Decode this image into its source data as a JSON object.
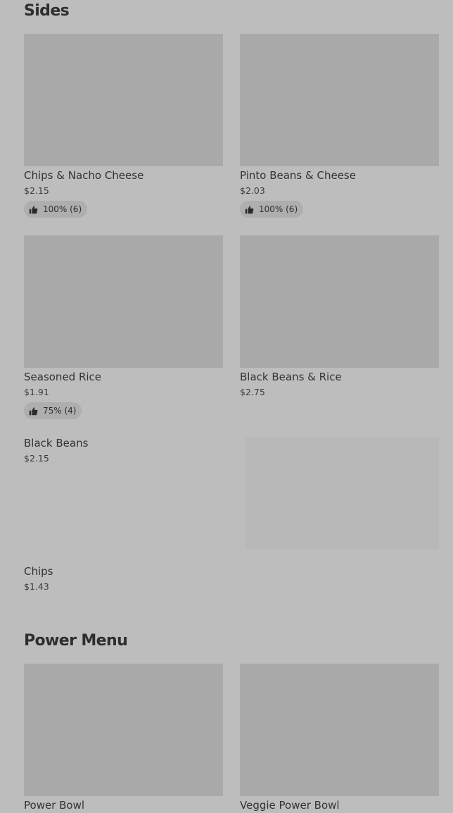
{
  "sides": {
    "title": "Sides",
    "items": [
      {
        "name": "Chips & Nacho Cheese",
        "price": "$2.15",
        "rating": "100% (6)"
      },
      {
        "name": "Pinto Beans & Cheese",
        "price": "$2.03",
        "rating": "100% (6)"
      },
      {
        "name": "Seasoned Rice",
        "price": "$1.91",
        "rating": "75% (4)"
      },
      {
        "name": "Black Beans & Rice",
        "price": "$2.75"
      },
      {
        "name": "Black Beans",
        "price": "$2.15"
      },
      {
        "name": "Chips",
        "price": "$1.43"
      }
    ]
  },
  "power_menu": {
    "title": "Power Menu",
    "items": [
      {
        "name": "Power Bowl"
      },
      {
        "name": "Veggie Power Bowl"
      }
    ]
  },
  "colors": {
    "background": "#bdbdbd",
    "image_placeholder": "#a9a9a9",
    "rating_chip": "#aeaeae"
  },
  "icons": {
    "rating": "thumbs-up-icon"
  }
}
